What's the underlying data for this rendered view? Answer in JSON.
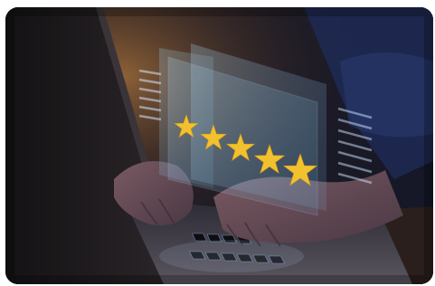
{
  "image": {
    "subject": "hands-typing-on-laptop-with-five-star-rating-overlay",
    "rating": {
      "value": 5,
      "max": 5,
      "star_color": "#f2c12e"
    },
    "palette": {
      "background_dark": "#1c1a1e",
      "warm_light": "#c9863f",
      "sleeve_blue": "#1e2a55",
      "panel_tint": "#8fc6e8",
      "key_glow": "#cfe4ff"
    }
  }
}
